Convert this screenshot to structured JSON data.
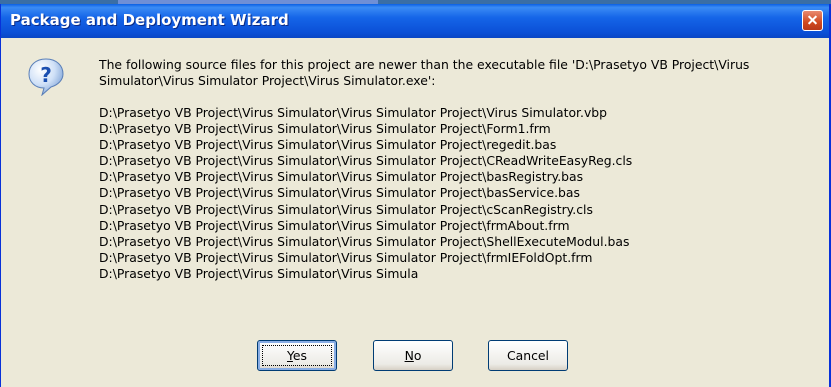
{
  "window": {
    "title": "Package and Deployment Wizard"
  },
  "icon": "question-icon",
  "message": {
    "intro": "The following source files for this project are newer than the executable file 'D:\\Prasetyo VB Project\\Virus Simulator\\Virus Simulator Project\\Virus Simulator.exe':",
    "files": [
      "D:\\Prasetyo VB Project\\Virus Simulator\\Virus Simulator Project\\Virus Simulator.vbp",
      "D:\\Prasetyo VB Project\\Virus Simulator\\Virus Simulator Project\\Form1.frm",
      "D:\\Prasetyo VB Project\\Virus Simulator\\Virus Simulator Project\\regedit.bas",
      "D:\\Prasetyo VB Project\\Virus Simulator\\Virus Simulator Project\\CReadWriteEasyReg.cls",
      "D:\\Prasetyo VB Project\\Virus Simulator\\Virus Simulator Project\\basRegistry.bas",
      "D:\\Prasetyo VB Project\\Virus Simulator\\Virus Simulator Project\\basService.bas",
      "D:\\Prasetyo VB Project\\Virus Simulator\\Virus Simulator Project\\cScanRegistry.cls",
      "D:\\Prasetyo VB Project\\Virus Simulator\\Virus Simulator Project\\frmAbout.frm",
      "D:\\Prasetyo VB Project\\Virus Simulator\\Virus Simulator Project\\ShellExecuteModul.bas",
      "D:\\Prasetyo VB Project\\Virus Simulator\\Virus Simulator Project\\frmIEFoldOpt.frm",
      "D:\\Prasetyo VB Project\\Virus Simulator\\Virus Simula"
    ]
  },
  "buttons": {
    "yes": {
      "mnemonic": "Y",
      "rest": "es"
    },
    "no": {
      "mnemonic": "N",
      "rest": "o"
    },
    "cancel": "Cancel"
  },
  "colors": {
    "titlebar": "#0a5fe3",
    "dialog_bg": "#ece9d8",
    "close_button": "#d0491f"
  }
}
